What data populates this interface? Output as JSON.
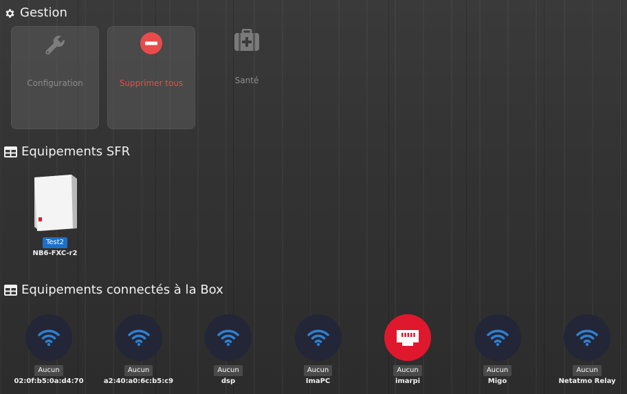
{
  "sections": {
    "gestion": "Gestion",
    "sfr": "Equipements SFR",
    "connected": "Equipements connectés à la Box"
  },
  "gestion_tiles": [
    {
      "label": "Configuration",
      "icon": "wrench-icon"
    },
    {
      "label": "Supprimer tous",
      "icon": "minus-circle-icon",
      "color": "#e94b4b"
    },
    {
      "label": "Santé",
      "icon": "medkit-icon"
    }
  ],
  "sfr_equipment": {
    "badge": "Test2",
    "name": "NB6-FXC-r2",
    "icon": "router-box-image"
  },
  "devices": [
    {
      "status": "Aucun",
      "name": "02:0f:b5:0a:d4:70",
      "icon": "wifi-icon"
    },
    {
      "status": "Aucun",
      "name": "a2:40:a0:6c:b5:c9",
      "icon": "wifi-icon"
    },
    {
      "status": "Aucun",
      "name": "dsp",
      "icon": "wifi-icon"
    },
    {
      "status": "Aucun",
      "name": "ImaPC",
      "icon": "wifi-icon"
    },
    {
      "status": "Aucun",
      "name": "imarpi",
      "icon": "ethernet-icon",
      "color": "#e0182d"
    },
    {
      "status": "Aucun",
      "name": "Migo",
      "icon": "wifi-icon"
    },
    {
      "status": "Aucun",
      "name": "Netatmo Relay",
      "icon": "wifi-icon"
    }
  ],
  "colors": {
    "accent_blue": "#1e6fc8",
    "wifi_blue": "#2f7fd0",
    "danger": "#e94b4b",
    "ethernet_red": "#e0182d"
  }
}
